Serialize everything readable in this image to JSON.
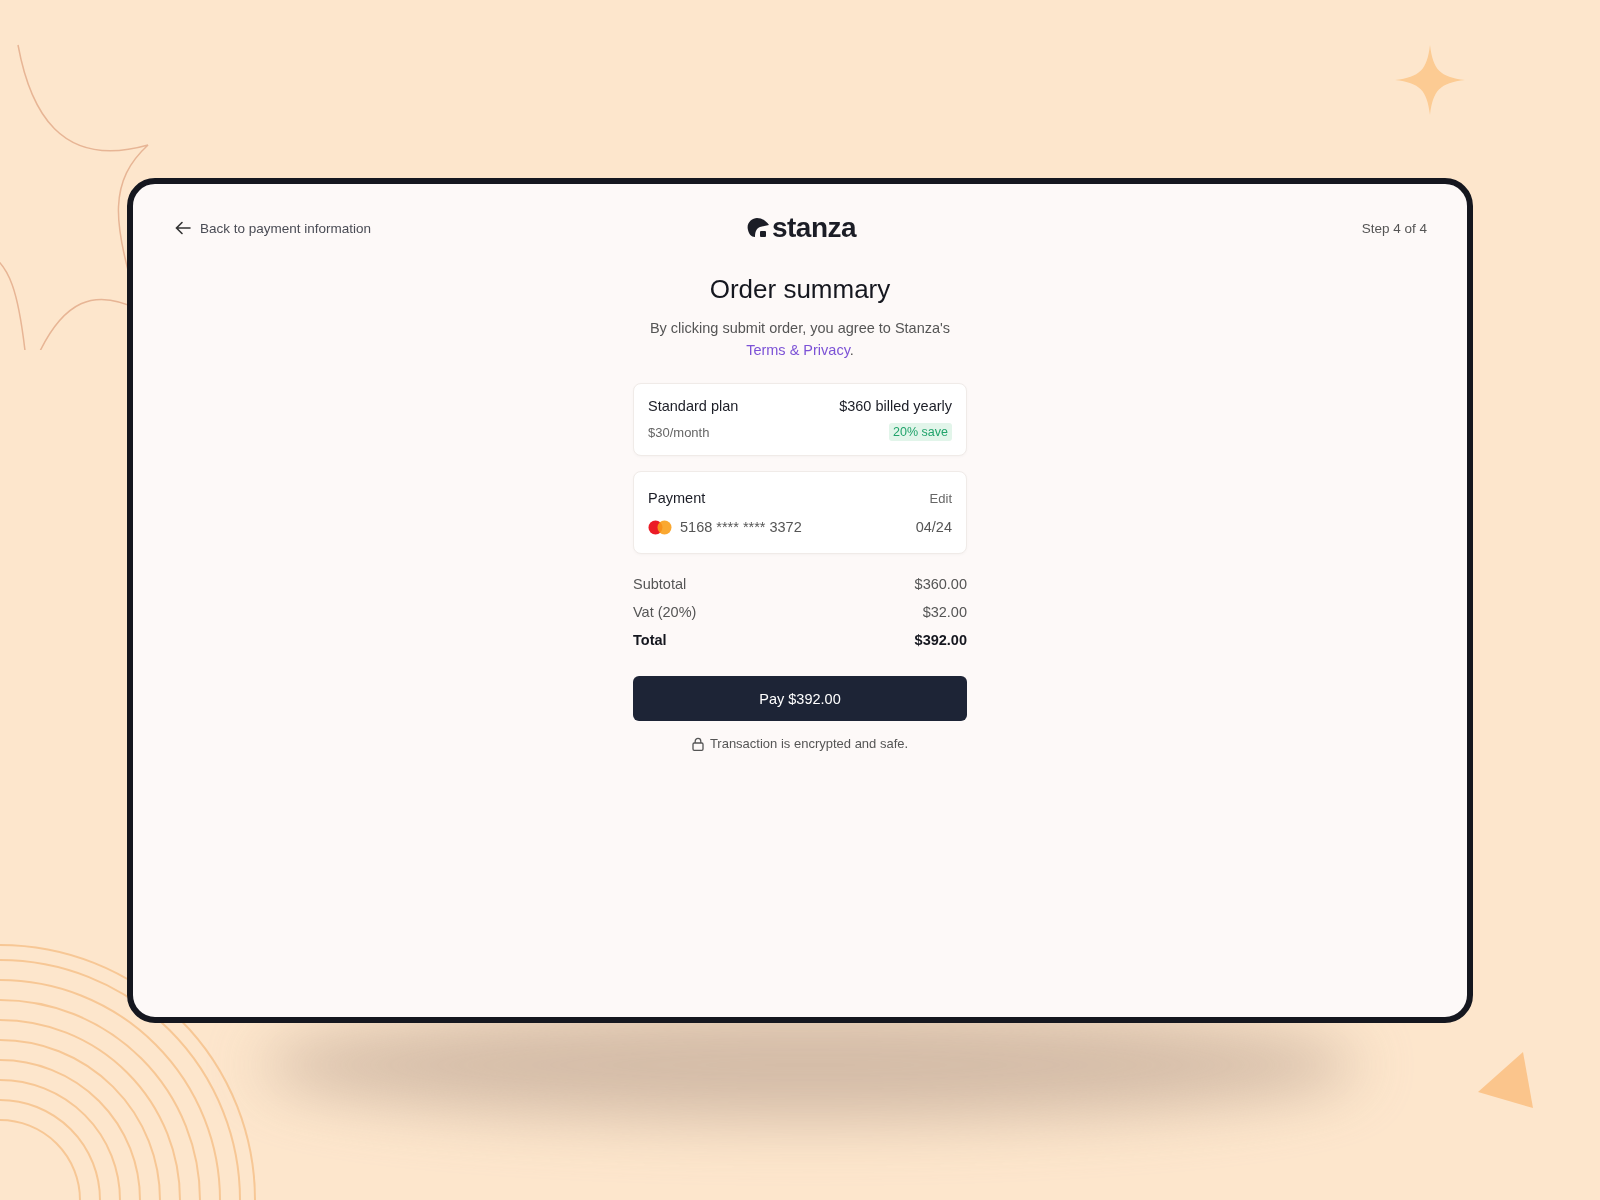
{
  "header": {
    "back_link": "Back to payment information",
    "logo": "stanza",
    "step": "Step 4 of 4"
  },
  "title": "Order summary",
  "agreement": {
    "text": "By clicking submit order, you agree to Stanza's",
    "link": "Terms & Privacy",
    "after": "."
  },
  "plan": {
    "name": "Standard plan",
    "price": "$360 billed yearly",
    "monthly": "$30/month",
    "badge": "20% save"
  },
  "payment": {
    "title": "Payment",
    "edit": "Edit",
    "card_number": "5168 **** **** 3372",
    "expiry": "04/24"
  },
  "totals": [
    {
      "kind": "line",
      "label": "Subtotal",
      "value": "$360.00"
    },
    {
      "kind": "line",
      "label": "Vat (20%)",
      "value": "$32.00"
    },
    {
      "kind": "total",
      "label": "Total",
      "value": "$392.00"
    }
  ],
  "pay_button": "Pay $392.00",
  "secure_note": "Transaction is encrypted and safe."
}
